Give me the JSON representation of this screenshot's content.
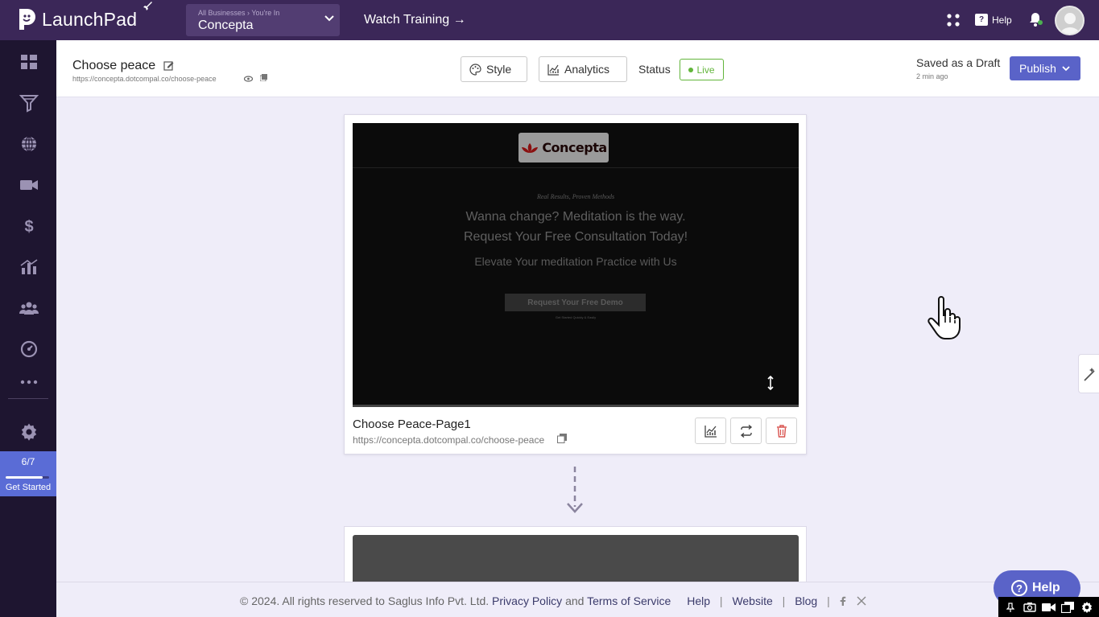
{
  "topbar": {
    "app_name": "LaunchPad",
    "business_crumb": "All Businesses › You're In",
    "business_name": "Concepta",
    "watch_training": "Watch Training →",
    "help_label": "Help"
  },
  "sidebar": {
    "items": [
      "dashboard-icon",
      "funnel-icon",
      "globe-icon",
      "video-icon",
      "dollar-icon",
      "analytics-icon",
      "users-icon",
      "gauge-icon",
      "more-icon"
    ],
    "settings_icon": "gear-icon",
    "progress_count": "6/7",
    "progress_fraction": 0.857,
    "progress_label": "Get Started"
  },
  "pagebar": {
    "title": "Choose peace",
    "url": "https://concepta.dotcompal.co/choose-peace",
    "style_label": "Style",
    "analytics_label": "Analytics",
    "status_label": "Status",
    "live_label": "Live",
    "draft_label": "Saved as a Draft",
    "draft_time": "2 min ago",
    "publish_label": "Publish"
  },
  "card": {
    "preview": {
      "logo_text": "Concepta",
      "tagline": "Real Results, Proven Methods",
      "headline_1": "Wanna change? Meditation is the way.",
      "headline_2": "Request Your Free Consultation Today!",
      "subheadline": "Elevate Your meditation Practice with Us",
      "cta": "Request Your Free Demo",
      "cta_note": "Get Started Quickly & Easily"
    },
    "title": "Choose Peace-Page1",
    "url": "https://concepta.dotcompal.co/choose-peace"
  },
  "footer": {
    "copyright": "©  2024. All rights reserved to Saglus Info Pvt. Ltd.",
    "privacy": "Privacy Policy",
    "and": "and",
    "terms": "Terms of Service",
    "help": "Help",
    "website": "Website",
    "blog": "Blog"
  },
  "help_float": "Help",
  "colors": {
    "topbar": "#3b2758",
    "sidebar": "#1e1530",
    "accent": "#5a63c8",
    "live": "#62b53b",
    "canvas": "#efedf9"
  }
}
